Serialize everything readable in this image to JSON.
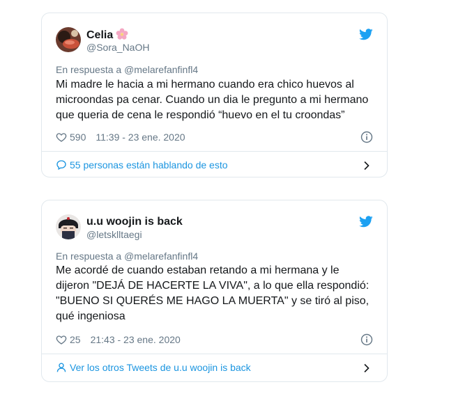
{
  "tweets": [
    {
      "name": "Celia",
      "handle": "@Sora_NaOH",
      "reply_prefix": "En respuesta a",
      "reply_mention": "@melarefanfinfl4",
      "text_lines": [
        "Mi madre le hacia a mi hermano cuando era chico huevos al",
        "microondas pa cenar. Cuando un dia le pregunto a mi hermano",
        "que queria de cena le respondió “huevo en el tu croondas”"
      ],
      "likes": "590",
      "timestamp": "11:39 - 23 ene. 2020",
      "footer": "55 personas están hablando de esto",
      "footer_icon": "speech-bubble-icon",
      "name_emoji_icon": "cherry-blossom-icon"
    },
    {
      "name": "u.u woojin is back",
      "handle": "@letsklltaegi",
      "reply_prefix": "En respuesta a",
      "reply_mention": "@melarefanfinfl4",
      "text_lines": [
        "Me acordé de cuando estaban retando a mi hermana y le",
        "dijeron \"DEJÁ DE HACERTE LA VIVA\", a lo que ella respondió:",
        "\"BUENO SI QUERÉS ME HAGO LA MUERTA\" y se tiró al piso,",
        "qué ingeniosa"
      ],
      "likes": "25",
      "timestamp": "21:43 - 23 ene. 2020",
      "footer": "Ver los otros Tweets de u.u woojin is back",
      "footer_icon": "person-icon"
    }
  ],
  "colors": {
    "link_blue": "#1b95e0",
    "twitter_blue": "#1da1f2",
    "secondary_text": "#657786",
    "border": "#e1e8ed"
  }
}
